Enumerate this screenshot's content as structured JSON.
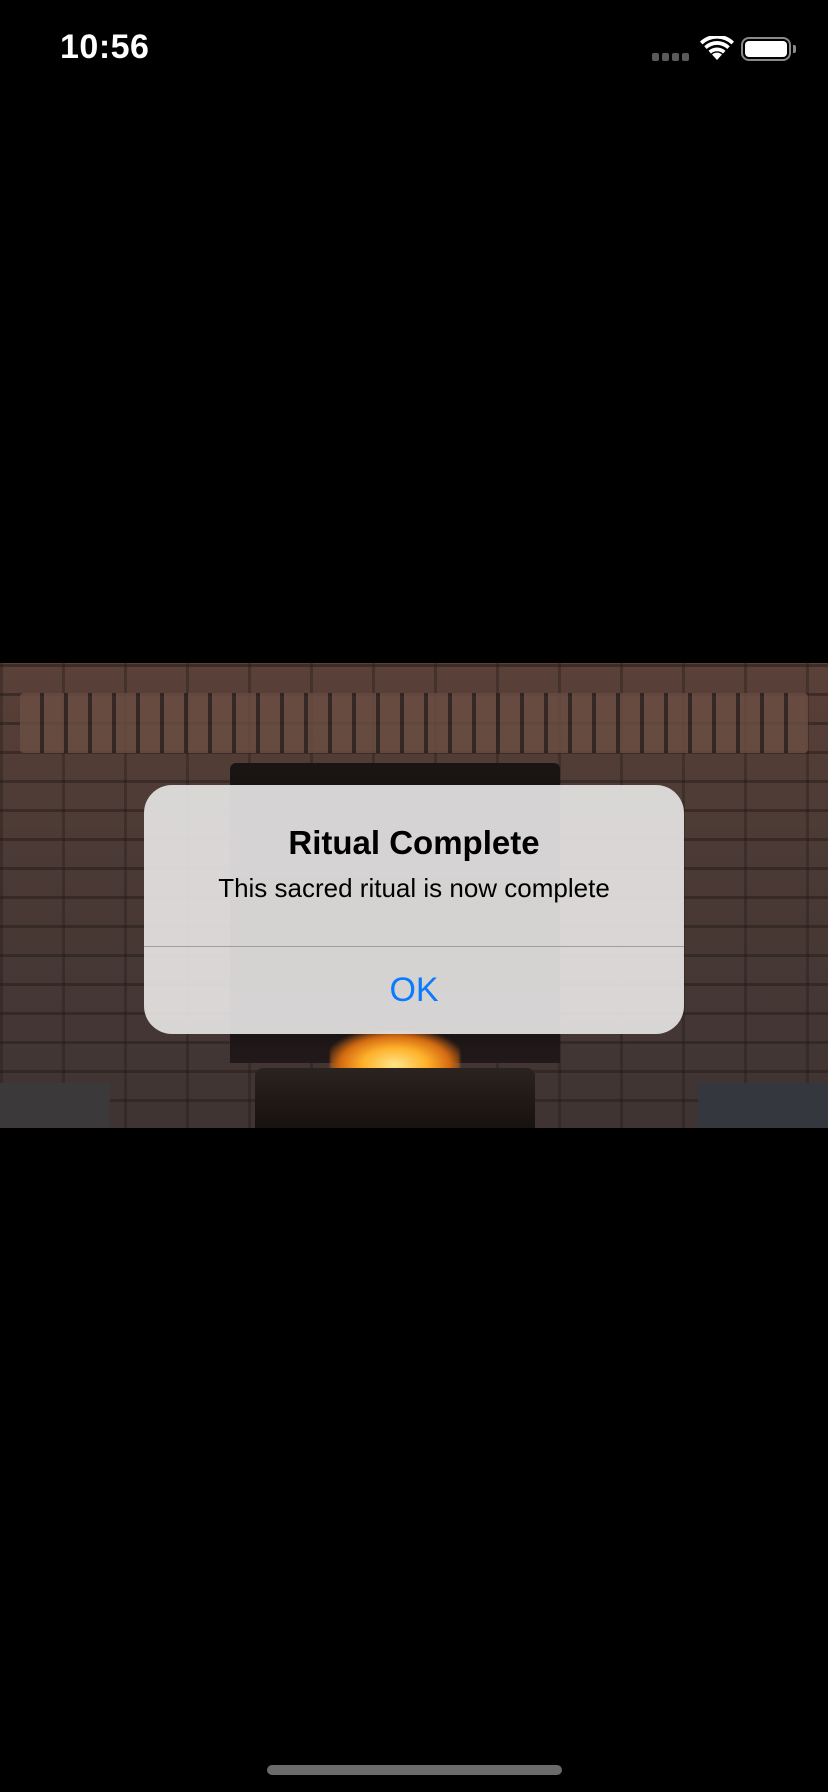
{
  "status_bar": {
    "time": "10:56",
    "cellular_icon": "cellular-signal-icon",
    "wifi_icon": "wifi-icon",
    "battery_icon": "battery-icon",
    "battery_level": 1.0
  },
  "background": {
    "image": "fireplace-photo"
  },
  "alert": {
    "title": "Ritual Complete",
    "message": "This sacred ritual is now complete",
    "ok_label": "OK",
    "ok_color": "#0a7aff"
  }
}
